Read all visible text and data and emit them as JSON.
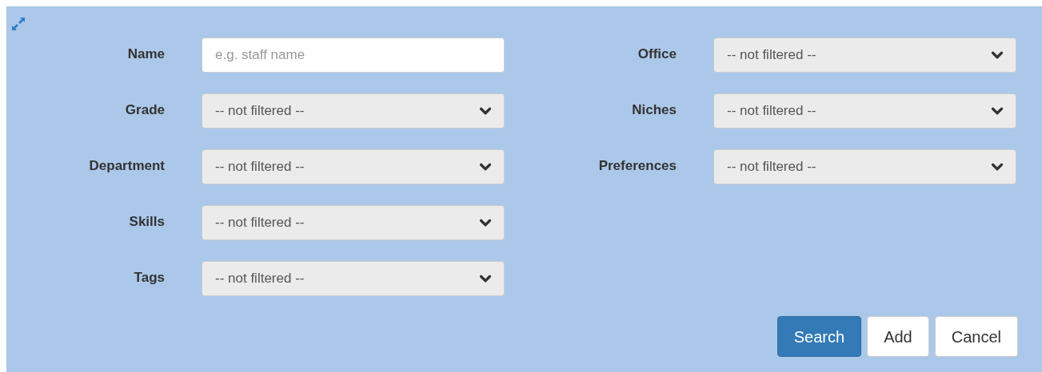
{
  "left_fields": [
    {
      "kind": "text",
      "label": "Name",
      "placeholder": "e.g. staff name"
    },
    {
      "kind": "select",
      "label": "Grade",
      "value": "-- not filtered --"
    },
    {
      "kind": "select",
      "label": "Department",
      "value": "-- not filtered --"
    },
    {
      "kind": "select",
      "label": "Skills",
      "value": "-- not filtered --"
    },
    {
      "kind": "select",
      "label": "Tags",
      "value": "-- not filtered --"
    }
  ],
  "right_fields": [
    {
      "kind": "select",
      "label": "Office",
      "value": "-- not filtered --"
    },
    {
      "kind": "select",
      "label": "Niches",
      "value": "-- not filtered --"
    },
    {
      "kind": "select",
      "label": "Preferences",
      "value": "-- not filtered --"
    }
  ],
  "buttons": [
    {
      "kind": "primary",
      "label": "Search"
    },
    {
      "kind": "default",
      "label": "Add"
    },
    {
      "kind": "default",
      "label": "Cancel"
    }
  ]
}
